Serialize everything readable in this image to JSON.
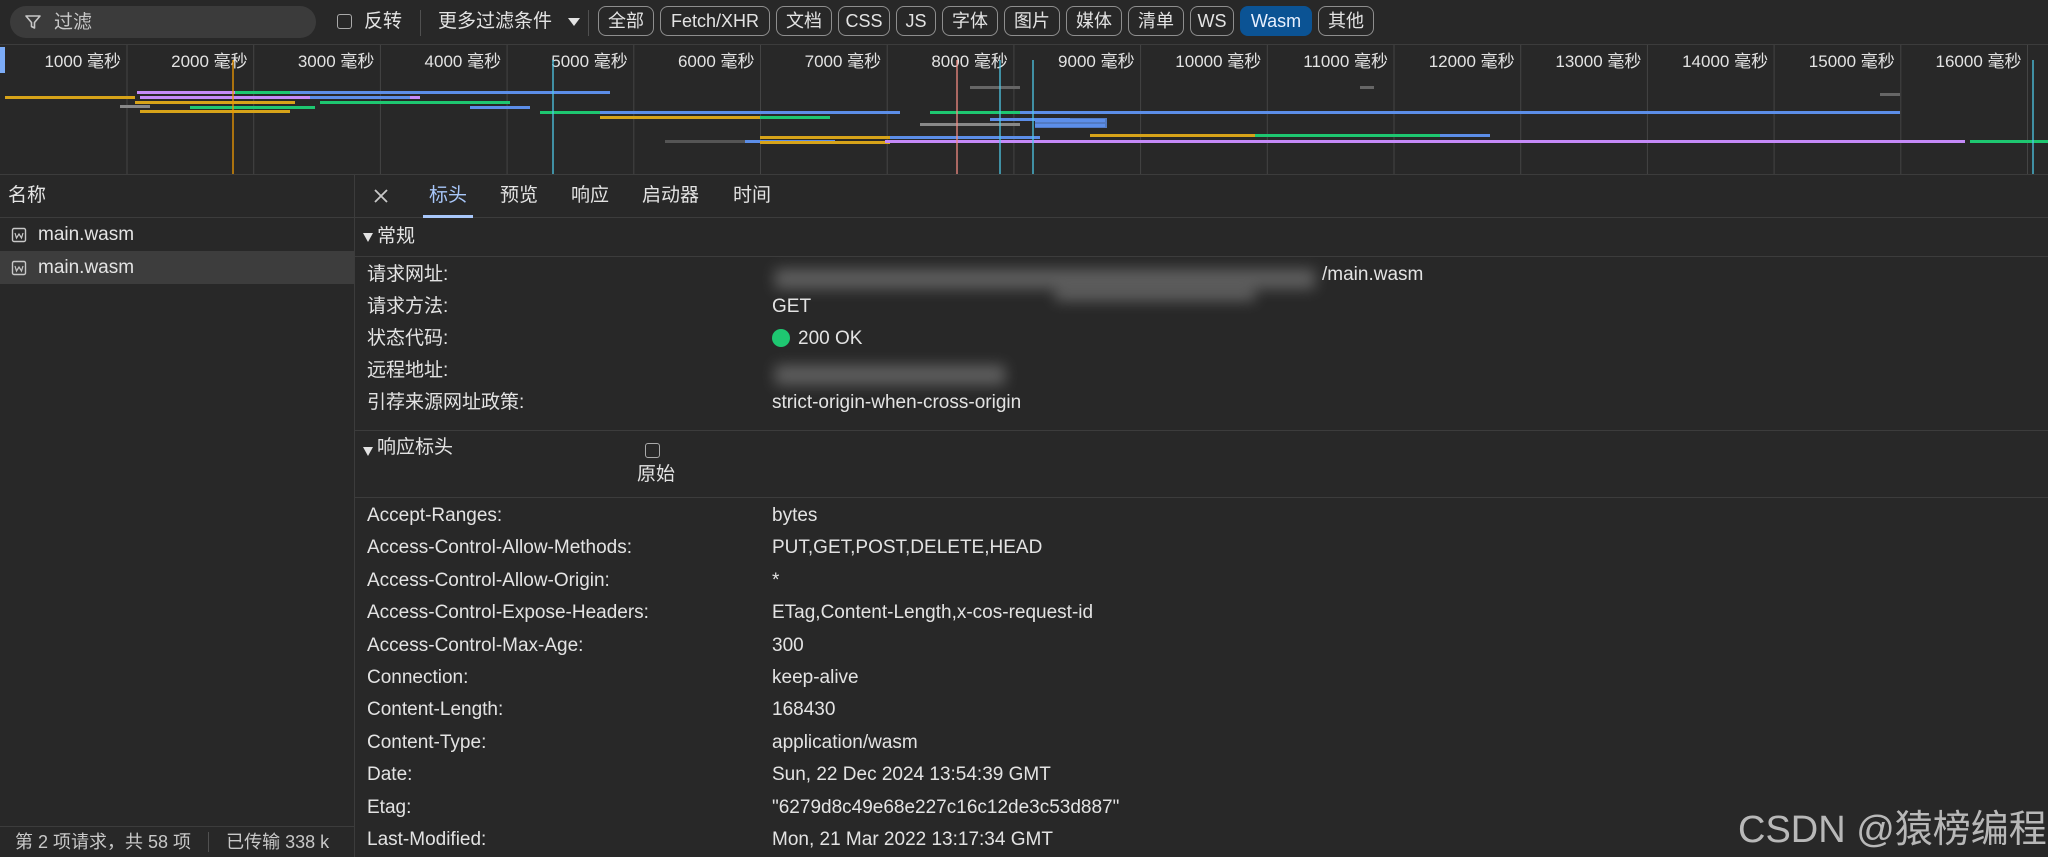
{
  "toolbar": {
    "filter_placeholder": "过滤",
    "invert_label": "反转",
    "more_filters_label": "更多过滤条件",
    "type_filters": [
      "全部",
      "Fetch/XHR",
      "文档",
      "CSS",
      "JS",
      "字体",
      "图片",
      "媒体",
      "清单",
      "WS",
      "Wasm",
      "其他"
    ],
    "active_type": "Wasm"
  },
  "overview": {
    "ticks": [
      "1000 毫秒",
      "2000 毫秒",
      "3000 毫秒",
      "4000 毫秒",
      "5000 毫秒",
      "6000 毫秒",
      "7000 毫秒",
      "8000 毫秒",
      "9000 毫秒",
      "10000 毫秒",
      "11000 毫秒",
      "12000 毫秒",
      "13000 毫秒",
      "14000 毫秒",
      "15000 毫秒",
      "16000 毫秒"
    ]
  },
  "requests": {
    "header": "名称",
    "items": [
      "main.wasm",
      "main.wasm"
    ],
    "selected_index": 1,
    "status_left": "第 2 项请求，共 58 项",
    "status_right": "已传输 338 k"
  },
  "detail": {
    "tabs": [
      "标头",
      "预览",
      "响应",
      "启动器",
      "时间"
    ],
    "active_tab": "标头",
    "general": {
      "title": "常规",
      "rows": [
        {
          "key": "请求网址:",
          "value": "/main.wasm"
        },
        {
          "key": "请求方法:",
          "value": "GET"
        },
        {
          "key": "状态代码:",
          "value": "200 OK"
        },
        {
          "key": "远程地址:",
          "value": ""
        },
        {
          "key": "引荐来源网址政策:",
          "value": "strict-origin-when-cross-origin"
        }
      ]
    },
    "response_headers": {
      "title": "响应标头",
      "raw_label": "原始",
      "rows": [
        {
          "key": "Accept-Ranges:",
          "value": "bytes"
        },
        {
          "key": "Access-Control-Allow-Methods:",
          "value": "PUT,GET,POST,DELETE,HEAD"
        },
        {
          "key": "Access-Control-Allow-Origin:",
          "value": "*"
        },
        {
          "key": "Access-Control-Expose-Headers:",
          "value": "ETag,Content-Length,x-cos-request-id"
        },
        {
          "key": "Access-Control-Max-Age:",
          "value": "300"
        },
        {
          "key": "Connection:",
          "value": "keep-alive"
        },
        {
          "key": "Content-Length:",
          "value": "168430"
        },
        {
          "key": "Content-Type:",
          "value": "application/wasm"
        },
        {
          "key": "Date:",
          "value": "Sun, 22 Dec 2024 13:54:39 GMT"
        },
        {
          "key": "Etag:",
          "value": "\"6279d8c49e68e227c16c12de3c53d887\""
        },
        {
          "key": "Last-Modified:",
          "value": "Mon, 21 Mar 2022 13:17:34 GMT"
        }
      ]
    }
  },
  "watermark": "CSDN @猿榜编程",
  "colors": {
    "accent": "#a8c7fa",
    "active_chip": "#0b5394",
    "status_ok": "#1ec771"
  }
}
